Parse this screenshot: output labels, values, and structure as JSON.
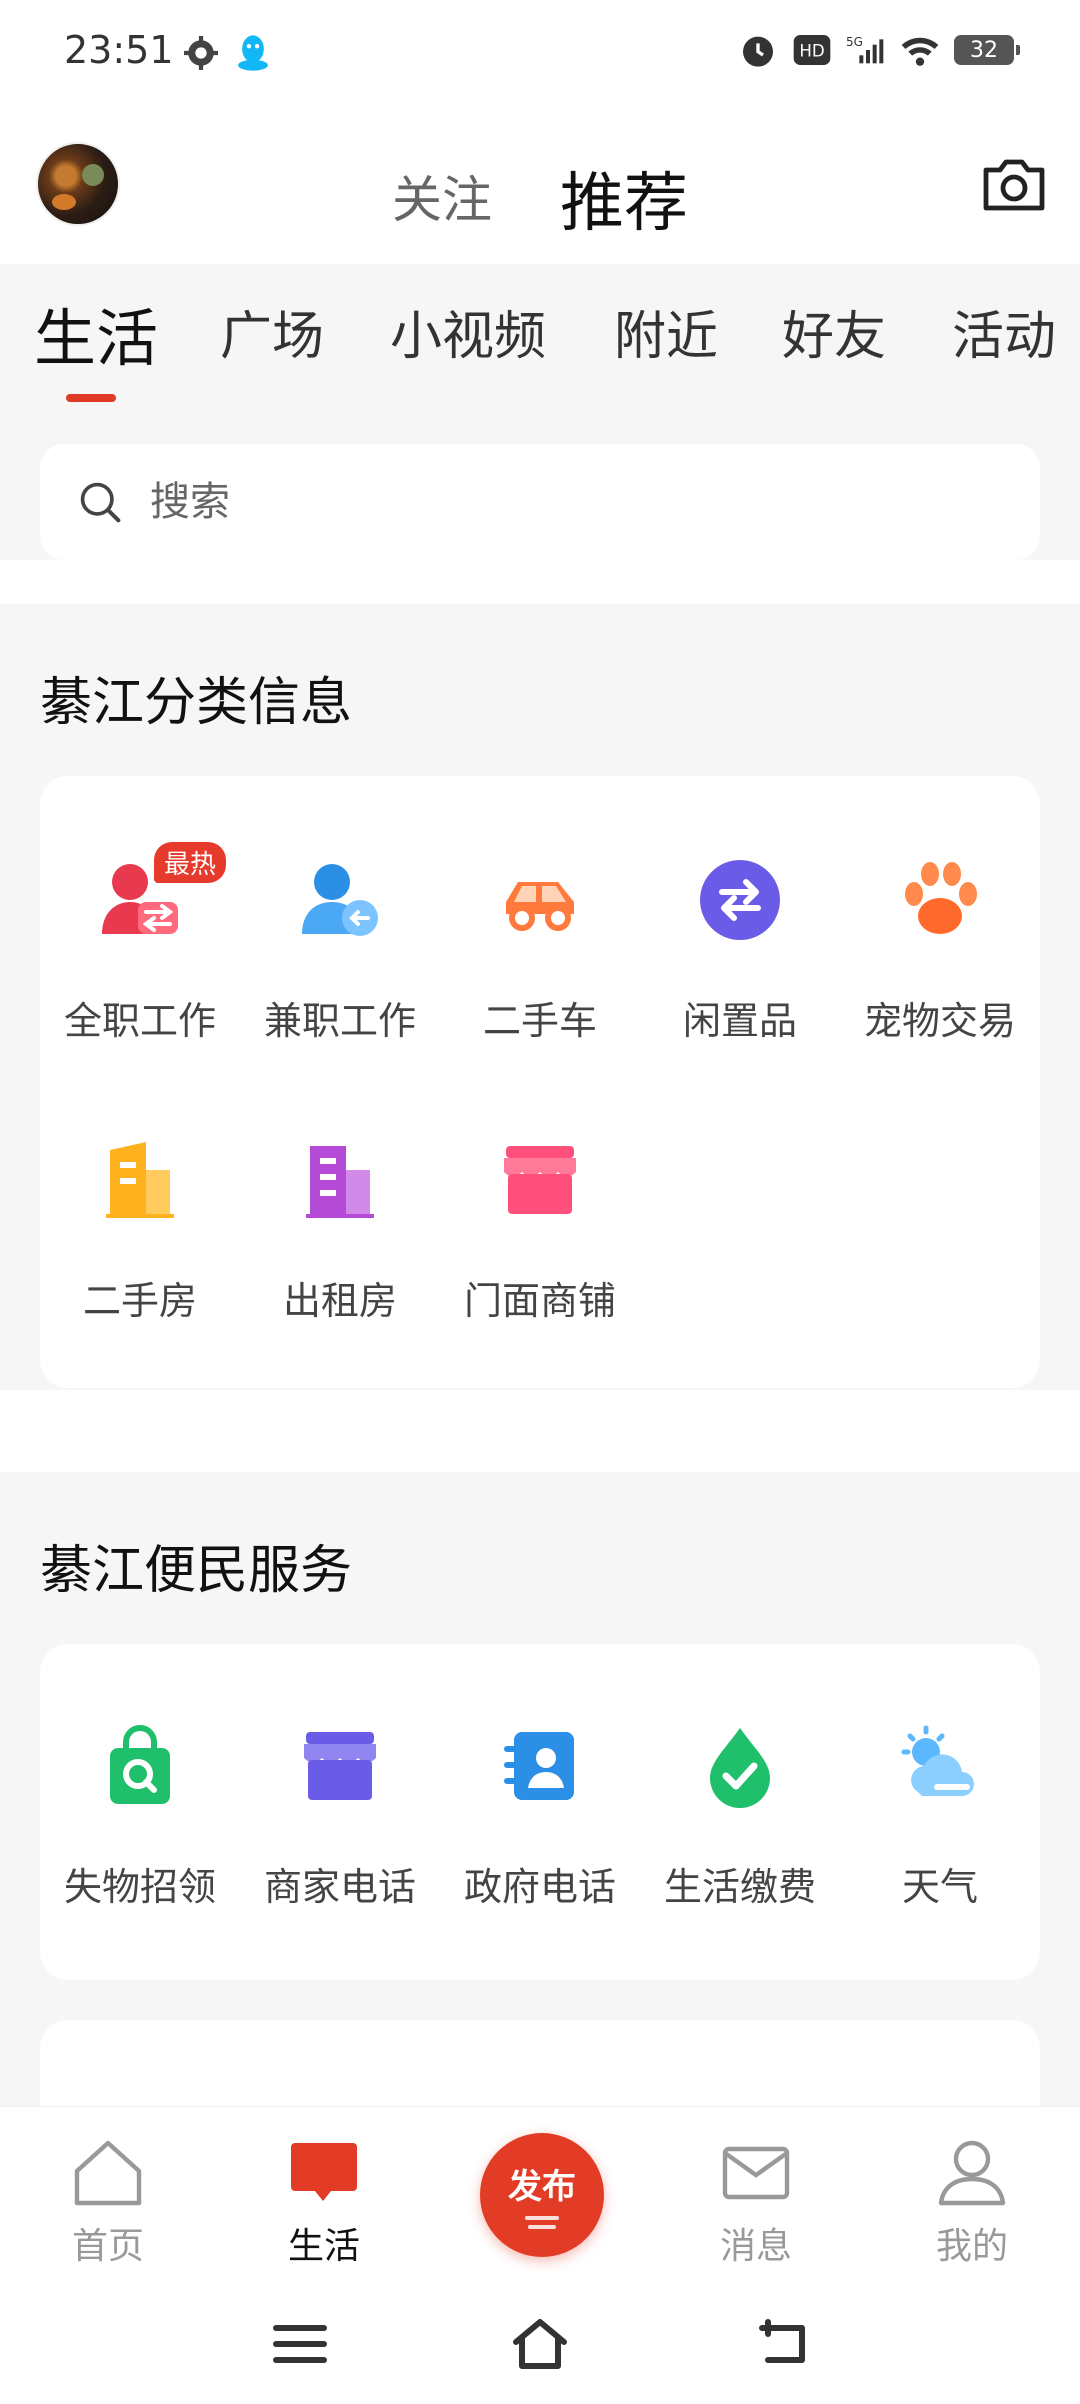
{
  "status_bar": {
    "time": "23:51",
    "battery": "32",
    "hd": "HD",
    "net": "5G"
  },
  "header": {
    "follow": "关注",
    "recommend": "推荐"
  },
  "categories": [
    "生活",
    "广场",
    "小视频",
    "附近",
    "好友",
    "活动"
  ],
  "search": {
    "placeholder": "搜索"
  },
  "classified": {
    "title": "綦江分类信息",
    "hot_badge": "最热",
    "items": [
      {
        "label": "全职工作",
        "icon": "person-exchange-icon"
      },
      {
        "label": "兼职工作",
        "icon": "person-arrow-icon"
      },
      {
        "label": "二手车",
        "icon": "car-icon"
      },
      {
        "label": "闲置品",
        "icon": "swap-icon"
      },
      {
        "label": "宠物交易",
        "icon": "paw-icon"
      },
      {
        "label": "二手房",
        "icon": "building-icon"
      },
      {
        "label": "出租房",
        "icon": "rental-building-icon"
      },
      {
        "label": "门面商铺",
        "icon": "shop-icon"
      }
    ]
  },
  "services": {
    "title": "綦江便民服务",
    "items": [
      {
        "label": "失物招领",
        "icon": "lost-found-bag-icon"
      },
      {
        "label": "商家电话",
        "icon": "store-icon"
      },
      {
        "label": "政府电话",
        "icon": "contact-card-icon"
      },
      {
        "label": "生活缴费",
        "icon": "water-drop-check-icon"
      },
      {
        "label": "天气",
        "icon": "weather-icon"
      }
    ]
  },
  "bottom_nav": {
    "home": "首页",
    "life": "生活",
    "publish": "发布",
    "messages": "消息",
    "mine": "我的"
  },
  "colors": {
    "accent": "#e23b26",
    "background": "#f6f6f6"
  }
}
